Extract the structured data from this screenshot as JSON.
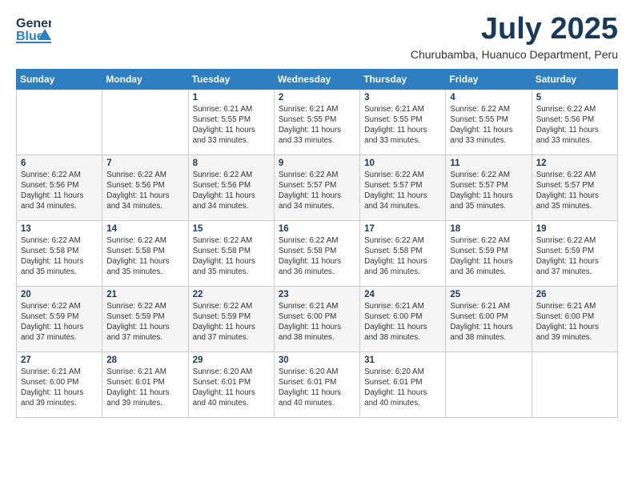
{
  "header": {
    "logo_general": "General",
    "logo_blue": "Blue",
    "month_title": "July 2025",
    "subtitle": "Churubamba, Huanuco Department, Peru"
  },
  "weekdays": [
    "Sunday",
    "Monday",
    "Tuesday",
    "Wednesday",
    "Thursday",
    "Friday",
    "Saturday"
  ],
  "weeks": [
    [
      {
        "day": "",
        "info": ""
      },
      {
        "day": "",
        "info": ""
      },
      {
        "day": "1",
        "info": "Sunrise: 6:21 AM\nSunset: 5:55 PM\nDaylight: 11 hours and 33 minutes."
      },
      {
        "day": "2",
        "info": "Sunrise: 6:21 AM\nSunset: 5:55 PM\nDaylight: 11 hours and 33 minutes."
      },
      {
        "day": "3",
        "info": "Sunrise: 6:21 AM\nSunset: 5:55 PM\nDaylight: 11 hours and 33 minutes."
      },
      {
        "day": "4",
        "info": "Sunrise: 6:22 AM\nSunset: 5:55 PM\nDaylight: 11 hours and 33 minutes."
      },
      {
        "day": "5",
        "info": "Sunrise: 6:22 AM\nSunset: 5:56 PM\nDaylight: 11 hours and 33 minutes."
      }
    ],
    [
      {
        "day": "6",
        "info": "Sunrise: 6:22 AM\nSunset: 5:56 PM\nDaylight: 11 hours and 34 minutes."
      },
      {
        "day": "7",
        "info": "Sunrise: 6:22 AM\nSunset: 5:56 PM\nDaylight: 11 hours and 34 minutes."
      },
      {
        "day": "8",
        "info": "Sunrise: 6:22 AM\nSunset: 5:56 PM\nDaylight: 11 hours and 34 minutes."
      },
      {
        "day": "9",
        "info": "Sunrise: 6:22 AM\nSunset: 5:57 PM\nDaylight: 11 hours and 34 minutes."
      },
      {
        "day": "10",
        "info": "Sunrise: 6:22 AM\nSunset: 5:57 PM\nDaylight: 11 hours and 34 minutes."
      },
      {
        "day": "11",
        "info": "Sunrise: 6:22 AM\nSunset: 5:57 PM\nDaylight: 11 hours and 35 minutes."
      },
      {
        "day": "12",
        "info": "Sunrise: 6:22 AM\nSunset: 5:57 PM\nDaylight: 11 hours and 35 minutes."
      }
    ],
    [
      {
        "day": "13",
        "info": "Sunrise: 6:22 AM\nSunset: 5:58 PM\nDaylight: 11 hours and 35 minutes."
      },
      {
        "day": "14",
        "info": "Sunrise: 6:22 AM\nSunset: 5:58 PM\nDaylight: 11 hours and 35 minutes."
      },
      {
        "day": "15",
        "info": "Sunrise: 6:22 AM\nSunset: 5:58 PM\nDaylight: 11 hours and 35 minutes."
      },
      {
        "day": "16",
        "info": "Sunrise: 6:22 AM\nSunset: 5:58 PM\nDaylight: 11 hours and 36 minutes."
      },
      {
        "day": "17",
        "info": "Sunrise: 6:22 AM\nSunset: 5:58 PM\nDaylight: 11 hours and 36 minutes."
      },
      {
        "day": "18",
        "info": "Sunrise: 6:22 AM\nSunset: 5:59 PM\nDaylight: 11 hours and 36 minutes."
      },
      {
        "day": "19",
        "info": "Sunrise: 6:22 AM\nSunset: 5:59 PM\nDaylight: 11 hours and 37 minutes."
      }
    ],
    [
      {
        "day": "20",
        "info": "Sunrise: 6:22 AM\nSunset: 5:59 PM\nDaylight: 11 hours and 37 minutes."
      },
      {
        "day": "21",
        "info": "Sunrise: 6:22 AM\nSunset: 5:59 PM\nDaylight: 11 hours and 37 minutes."
      },
      {
        "day": "22",
        "info": "Sunrise: 6:22 AM\nSunset: 5:59 PM\nDaylight: 11 hours and 37 minutes."
      },
      {
        "day": "23",
        "info": "Sunrise: 6:21 AM\nSunset: 6:00 PM\nDaylight: 11 hours and 38 minutes."
      },
      {
        "day": "24",
        "info": "Sunrise: 6:21 AM\nSunset: 6:00 PM\nDaylight: 11 hours and 38 minutes."
      },
      {
        "day": "25",
        "info": "Sunrise: 6:21 AM\nSunset: 6:00 PM\nDaylight: 11 hours and 38 minutes."
      },
      {
        "day": "26",
        "info": "Sunrise: 6:21 AM\nSunset: 6:00 PM\nDaylight: 11 hours and 39 minutes."
      }
    ],
    [
      {
        "day": "27",
        "info": "Sunrise: 6:21 AM\nSunset: 6:00 PM\nDaylight: 11 hours and 39 minutes."
      },
      {
        "day": "28",
        "info": "Sunrise: 6:21 AM\nSunset: 6:01 PM\nDaylight: 11 hours and 39 minutes."
      },
      {
        "day": "29",
        "info": "Sunrise: 6:20 AM\nSunset: 6:01 PM\nDaylight: 11 hours and 40 minutes."
      },
      {
        "day": "30",
        "info": "Sunrise: 6:20 AM\nSunset: 6:01 PM\nDaylight: 11 hours and 40 minutes."
      },
      {
        "day": "31",
        "info": "Sunrise: 6:20 AM\nSunset: 6:01 PM\nDaylight: 11 hours and 40 minutes."
      },
      {
        "day": "",
        "info": ""
      },
      {
        "day": "",
        "info": ""
      }
    ]
  ]
}
